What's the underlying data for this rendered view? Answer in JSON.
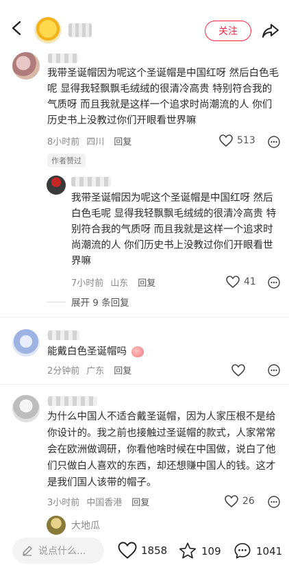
{
  "header": {
    "follow_label": "关注",
    "icons": [
      "back-arrow-icon",
      "share-icon"
    ]
  },
  "comments": [
    {
      "text": "我带圣诞帽因为呢这个圣诞帽是中国红呀 然后白色毛呢 显得我轻飘飘毛绒绒的很清冷高贵 特别符合我的气质呀 而且我就是这样一个追求时尚潮流的人 你们历史书上没教过你们开眼看世界嘛",
      "time": "8小时前",
      "location": "四川",
      "reply_label": "回复",
      "likes": "513",
      "badge": "作者赞过"
    },
    {
      "text": "我带圣诞帽因为呢这个圣诞帽是中国红呀 然后白色毛呢 显得我轻飘飘毛绒绒的很清冷高贵 特别符合我的气质呀 而且我就是这样一个追求时尚潮流的人 你们历史书上没教过你们开眼看世界嘛",
      "time": "7小时前",
      "location": "山东",
      "reply_label": "回复",
      "likes": "41",
      "expand_label": "展开 9 条回复"
    },
    {
      "text": "能戴白色圣诞帽吗",
      "time": "2分钟前",
      "location": "广东",
      "reply_label": "回复"
    },
    {
      "text": "为什么中国人不适合戴圣诞帽，因为人家压根不是给你设计的。我之前也接触过圣诞帽的款式，人家常常会在欧洲做调研，你看他啥时候在中国做，说白了他们只做白人喜欢的东西，却还想赚中国人的钱。这才是我们国人该带的帽子。",
      "time": "3小时前",
      "location": "中国香港",
      "reply_label": "回复",
      "likes": "26"
    },
    {
      "name": "大地瓜"
    }
  ],
  "bottom": {
    "placeholder": "说点什么...",
    "likes": "1858",
    "stars": "109",
    "comments": "1041"
  },
  "colors": {
    "accent": "#ff2442",
    "muted": "#8a8a8a"
  }
}
